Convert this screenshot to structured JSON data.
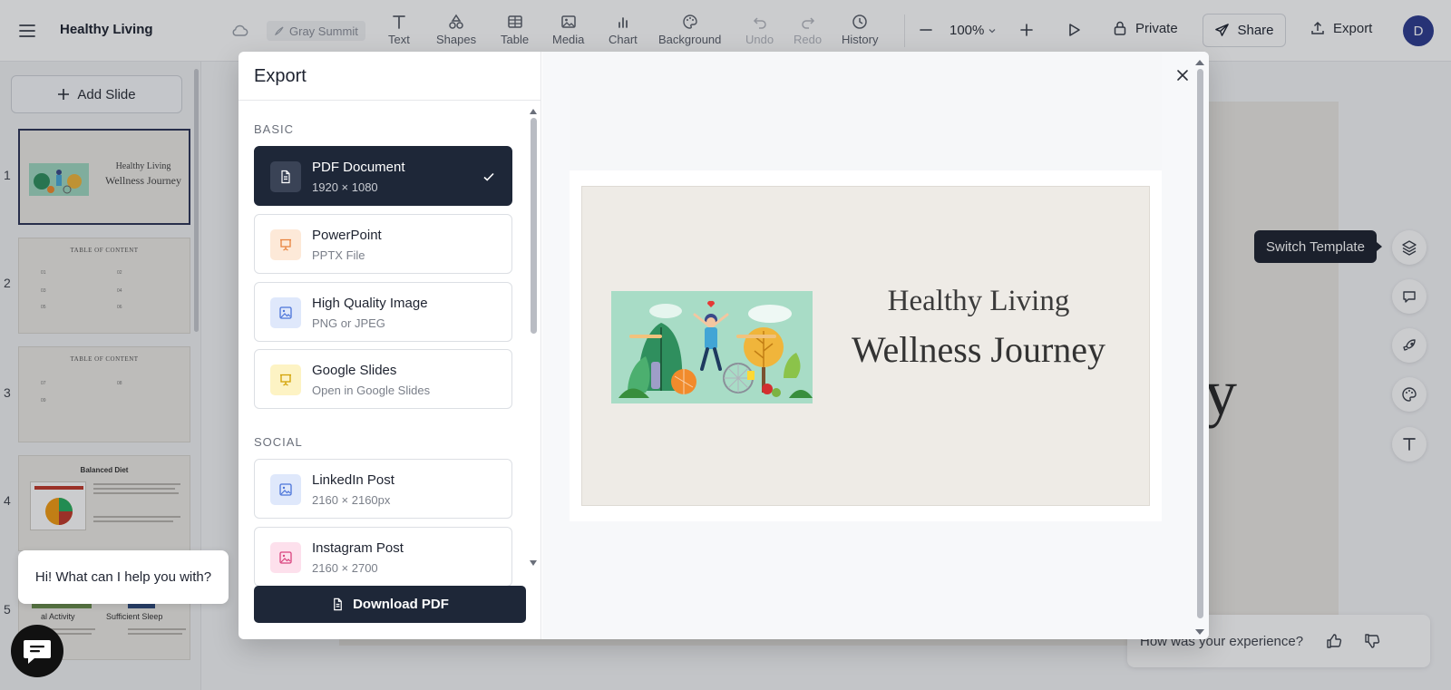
{
  "app": {
    "title": "Healthy Living",
    "theme": "Gray Summit"
  },
  "toolbar": {
    "tools": [
      {
        "id": "text",
        "label": "Text",
        "icon": "text-icon"
      },
      {
        "id": "shapes",
        "label": "Shapes",
        "icon": "shapes-icon"
      },
      {
        "id": "table",
        "label": "Table",
        "icon": "table-icon"
      },
      {
        "id": "media",
        "label": "Media",
        "icon": "image-icon"
      },
      {
        "id": "chart",
        "label": "Chart",
        "icon": "chart-icon"
      },
      {
        "id": "background",
        "label": "Background",
        "icon": "palette-icon"
      },
      {
        "id": "undo",
        "label": "Undo",
        "icon": "undo-icon"
      },
      {
        "id": "redo",
        "label": "Redo",
        "icon": "redo-icon"
      },
      {
        "id": "history",
        "label": "History",
        "icon": "clock-icon"
      }
    ],
    "zoom": "100%",
    "privacy": "Private",
    "share": "Share",
    "export": "Export",
    "avatar_initial": "D"
  },
  "sidebar": {
    "add_slide": "Add Slide",
    "slides": [
      {
        "num": "1",
        "title_line1": "Healthy Living",
        "title_line2": "Wellness Journey"
      },
      {
        "num": "2",
        "title": "TABLE OF CONTENT",
        "rows": [
          "01",
          "02",
          "03",
          "04",
          "05",
          "06"
        ]
      },
      {
        "num": "3",
        "title": "TABLE OF CONTENT",
        "rows": [
          "07",
          "08",
          "09"
        ]
      },
      {
        "num": "4",
        "title": "Balanced Diet"
      },
      {
        "num": "5",
        "left_label": "al Activity",
        "right_label": "Sufficient Sleep"
      }
    ]
  },
  "canvas": {
    "visible_text": "ey"
  },
  "right_tools": {
    "tooltip": "Switch Template"
  },
  "feedback": {
    "question": "How was your experience?"
  },
  "chat": {
    "greeting": "Hi! What can I help you with?"
  },
  "export_modal": {
    "title": "Export",
    "sections": [
      {
        "label": "BASIC",
        "options": [
          {
            "id": "pdf",
            "name": "PDF Document",
            "sub": "1920 × 1080",
            "icon": "document-icon",
            "icon_bg": "#3a4356",
            "icon_color": "#ffffff",
            "selected": true
          },
          {
            "id": "pptx",
            "name": "PowerPoint",
            "sub": "PPTX File",
            "icon": "presentation-icon",
            "icon_bg": "#fde9d8",
            "icon_color": "#e8823c",
            "selected": false
          },
          {
            "id": "image",
            "name": "High Quality Image",
            "sub": "PNG or JPEG",
            "icon": "image-icon",
            "icon_bg": "#dfe8fb",
            "icon_color": "#4b74d9",
            "selected": false
          },
          {
            "id": "gslides",
            "name": "Google Slides",
            "sub": "Open in Google Slides",
            "icon": "presentation-icon",
            "icon_bg": "#fdf3c4",
            "icon_color": "#d1a000",
            "selected": false
          }
        ]
      },
      {
        "label": "SOCIAL",
        "options": [
          {
            "id": "linkedin",
            "name": "LinkedIn Post",
            "sub": "2160 × 2160px",
            "icon": "image-icon",
            "icon_bg": "#dfe8fb",
            "icon_color": "#4b74d9",
            "selected": false
          },
          {
            "id": "instagram",
            "name": "Instagram Post",
            "sub": "2160 × 2700",
            "icon": "image-icon",
            "icon_bg": "#fde0ec",
            "icon_color": "#d9437e",
            "selected": false
          }
        ]
      }
    ],
    "download": "Download PDF",
    "preview": {
      "line1": "Healthy Living",
      "line2": "Wellness Journey"
    }
  }
}
